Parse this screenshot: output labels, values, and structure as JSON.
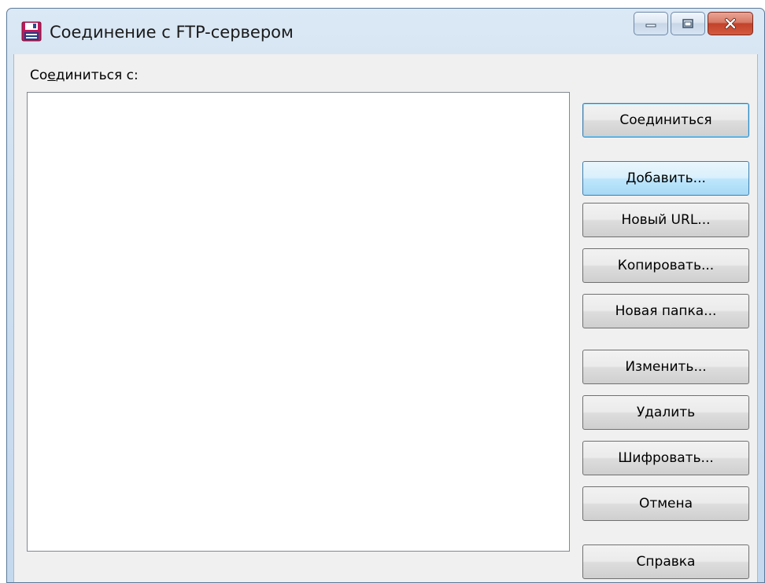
{
  "window": {
    "title": "Соединение с FTP-сервером"
  },
  "icons": {
    "app": "floppy-disk-icon",
    "minimize": "minimize-icon",
    "maximize": "maximize-icon",
    "close": "close-icon"
  },
  "dialog": {
    "label_prefix": "Со",
    "label_accel": "е",
    "label_suffix": "динитьcя с:",
    "buttons": {
      "connect": "Соединиться",
      "add": "Добавить...",
      "new_url": "Новый URL...",
      "copy": "Копировать...",
      "new_folder": "Новая папка...",
      "edit": "Изменить...",
      "delete": "Удалить",
      "encrypt": "Шифровать...",
      "cancel": "Отмена",
      "help": "Справка"
    }
  },
  "colors": {
    "accent": "#3c7fb1",
    "close": "#c2422b"
  }
}
